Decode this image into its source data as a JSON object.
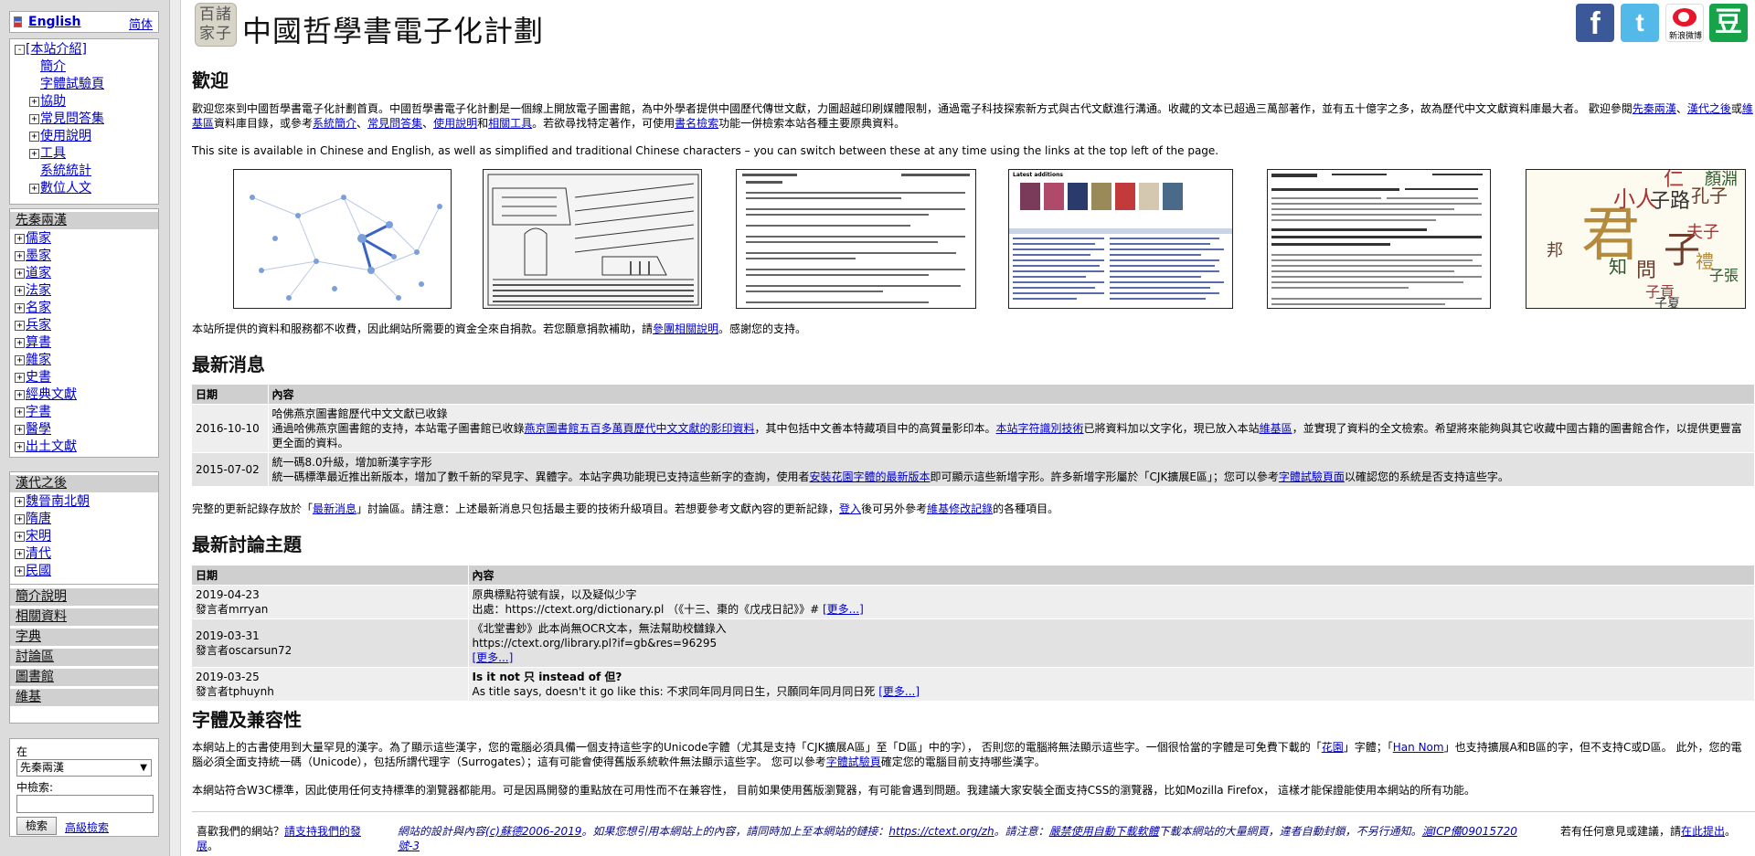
{
  "sidebar": {
    "language": {
      "english": "English",
      "simplified": "简体"
    },
    "intro": {
      "header": "[本站介紹]",
      "items": [
        {
          "label": "簡介",
          "toggle": ""
        },
        {
          "label": "字體試驗頁",
          "toggle": ""
        },
        {
          "label": "協助",
          "toggle": "+"
        },
        {
          "label": "常見問答集",
          "toggle": "+"
        },
        {
          "label": "使用說明",
          "toggle": "+"
        },
        {
          "label": "工具",
          "toggle": "+"
        },
        {
          "label": "系統統計",
          "toggle": ""
        },
        {
          "label": "數位人文",
          "toggle": "+"
        }
      ]
    },
    "pre_qin": {
      "header": "先秦兩漢",
      "items": [
        "儒家",
        "墨家",
        "道家",
        "法家",
        "名家",
        "兵家",
        "算書",
        "雜家",
        "史書",
        "經典文獻",
        "字書",
        "醫學",
        "出土文獻"
      ]
    },
    "post_han": {
      "header": "漢代之後",
      "items": [
        "魏晉南北朝",
        "隋唐",
        "宋明",
        "清代",
        "民國"
      ]
    },
    "links": [
      "簡介說明",
      "相關資料",
      "字典",
      "討論區",
      "圖書館",
      "維基"
    ],
    "search": {
      "in_label": "在",
      "scope": "先秦兩漢",
      "keyword_label": "中檢索:",
      "keyword_value": "",
      "button": "檢索",
      "advanced": "高級檢索"
    }
  },
  "header": {
    "logo_text": "百諸家子",
    "title": "中國哲學書電子化計劃",
    "social": {
      "weibo_label": "新浪微博"
    }
  },
  "welcome": {
    "heading": "歡迎",
    "p1_a": "歡迎您來到中國哲學書電子化計劃首頁。中國哲學書電子化計劃是一個線上開放電子圖書館，為中外學者提供中國歷代傳世文獻，力圖超越印刷媒體限制，通過電子科技探索新方式與古代文獻進行溝通。收藏的文本已超過三萬部著作，並有五十億字之多，故為歷代中文文獻資料庫最大者。 歡迎參閱",
    "p1_link1": "先秦兩漢",
    "p1_sep1": "、",
    "p1_link2": "漢代之後",
    "p1_or": "或",
    "p1_link3": "維基區",
    "p1_b": "資料庫目錄，或參考",
    "p1_link4": "系統簡介",
    "p1_sep2": "、",
    "p1_link5": "常見問答集",
    "p1_sep3": "、",
    "p1_link6": "使用說明",
    "p1_and": "和",
    "p1_link7": "相關工具",
    "p1_c": "。若欲尋找特定著作，可使用",
    "p1_link8": "書名檢索",
    "p1_d": "功能一併檢索本站各種主要原典資料。",
    "p2": "This site is available in Chinese and English, as well as simplified and traditional Chinese characters – you can switch between these at any time using the links at the top left of the page.",
    "p3_a": "本站所提供的資料和服務都不收費，因此網站所需要的資金全來自捐款。若您願意捐款補助，請",
    "p3_link": "參團相關說明",
    "p3_b": "。感謝您的支持。"
  },
  "thumbnails": {
    "t4_title": "Latest additions",
    "t6_words": [
      "君",
      "子",
      "小人",
      "子路",
      "孔子",
      "仁",
      "顏淵",
      "夫子",
      "問",
      "子貢",
      "邦",
      "子張",
      "禮",
      "知",
      "子夏"
    ]
  },
  "news": {
    "heading": "最新消息",
    "col_date": "日期",
    "col_content": "內容",
    "rows": [
      {
        "date": "2016-10-10",
        "title": "哈佛燕京圖書館歷代中文文獻已收錄",
        "t_a": "通過哈佛燕京圖書館的支持，本站電子圖書館已收錄",
        "link1": "燕京圖書館五百多萬頁歷代中文文獻的影印資料",
        "t_b": "，其中包括中文善本特藏項目中的高質量影印本。",
        "link2": "本站字符識別技術",
        "t_c": "已將資料加以文字化，現已放入本站",
        "link3": "維基區",
        "t_d": "，並實現了資料的全文檢索。希望將來能夠與其它收藏中國古籍的圖書館合作，以提供更豐富更全面的資料。"
      },
      {
        "date": "2015-07-02",
        "title": "統一碼8.0升級，增加新漢字字形",
        "t_a": "統一碼標準最近推出新版本，增加了數千新的罕見字、異體字。本站字典功能現已支持這些新字的查詢，使用者",
        "link1": "安裝花園字體的最新版本",
        "t_b": "即可顯示這些新增字形。許多新增字形屬於「CJK擴展E區」；您可以參考",
        "link2": "字體試驗頁面",
        "t_c": "以確認您的系統是否支持這些字。"
      }
    ],
    "footer_a": "完整的更新記錄存放於「",
    "footer_link1": "最新消息",
    "footer_b": "」討論區。請注意：上述最新消息只包括最主要的技術升級項目。若想要參考文獻內容的更新記錄，",
    "footer_link2": "登入",
    "footer_c": "後可另外參考",
    "footer_link3": "維基修改記錄",
    "footer_d": "的各種項目。"
  },
  "discussion": {
    "heading": "最新討論主題",
    "col_date": "日期",
    "col_content": "內容",
    "rows": [
      {
        "date": "2019-04-23",
        "author": "發言者mrryan",
        "title": "原典標點符號有誤，以及疑似少字",
        "body": "出處：https://ctext.org/dictionary.pl （《十三、棗的《戊戌日記》》# ",
        "more": "[更多...]",
        "bold": false
      },
      {
        "date": "2019-03-31",
        "author": "發言者oscarsun72",
        "title": "《北堂書鈔》此本尚無OCR文本，無法幫助校讎錄入",
        "body": "https://ctext.org/library.pl?if=gb&res=96295",
        "more": "[更多...]",
        "bold": false
      },
      {
        "date": "2019-03-25",
        "author": "發言者tphuynh",
        "title": "Is it not 只 instead of 但?",
        "body": "As title says, doesn't it go like this: 不求同年同月同日生，只願同年同月同日死 ",
        "more": "[更多...]",
        "bold": true
      }
    ]
  },
  "fonts": {
    "heading": "字體及兼容性",
    "p1_a": "本網站上的古書使用到大量罕見的漢字。為了顯示這些漢字，您的電腦必須具備一個支持這些字的Unicode字體（尤其是支持「CJK擴展A區」至「D區」中的字）， 否則您的電腦將無法顯示這些字。一個很恰當的字體是可免費下載的「",
    "p1_link1": "花園",
    "p1_b": "」字體；「",
    "p1_link2": "Han Nom",
    "p1_c": "」也支持擴展A和B區的字，但不支持C或D區。 此外，您的電腦必須全面支持統一碼（Unicode），包括所謂代理字（Surrogates）；這有可能會使得舊版系統軟件無法顯示這些字。 您可以參考",
    "p1_link3": "字體試驗頁",
    "p1_d": "確定您的電腦目前支持哪些漢字。",
    "p2": "本網站符合W3C標準，因此使用任何支持標準的瀏覽器都能用。可是因爲開發的重點放在可用性而不在兼容性， 目前如果使用舊版瀏覽器，有可能會遇到問題。我建議大家安裝全面支持CSS的瀏覽器，比如Mozilla Firefox， 這樣才能保證能使用本網站的所有功能。"
  },
  "footer": {
    "support_a": "喜歡我們的網站？",
    "support_link": "請支持我們的發展",
    "support_b": "。",
    "copy_a": "網站的設計與內容",
    "copy_link": "(c)蘇德2006-2019",
    "copy_b": "。如果您想引用本網站上的內容，請同時加上至本網站的鏈接：",
    "copy_url": "https://ctext.org/zh",
    "copy_c": "。請注意：",
    "copy_warn": "嚴禁使用自動下載軟體",
    "copy_d": "下載本網站的大量網頁，違者自動封鎖，不另行通知。",
    "copy_icp": "滬ICP備09015720號-3",
    "feedback_a": "若有任何意見或建議，請",
    "feedback_link": "在此提出",
    "feedback_b": "。"
  }
}
